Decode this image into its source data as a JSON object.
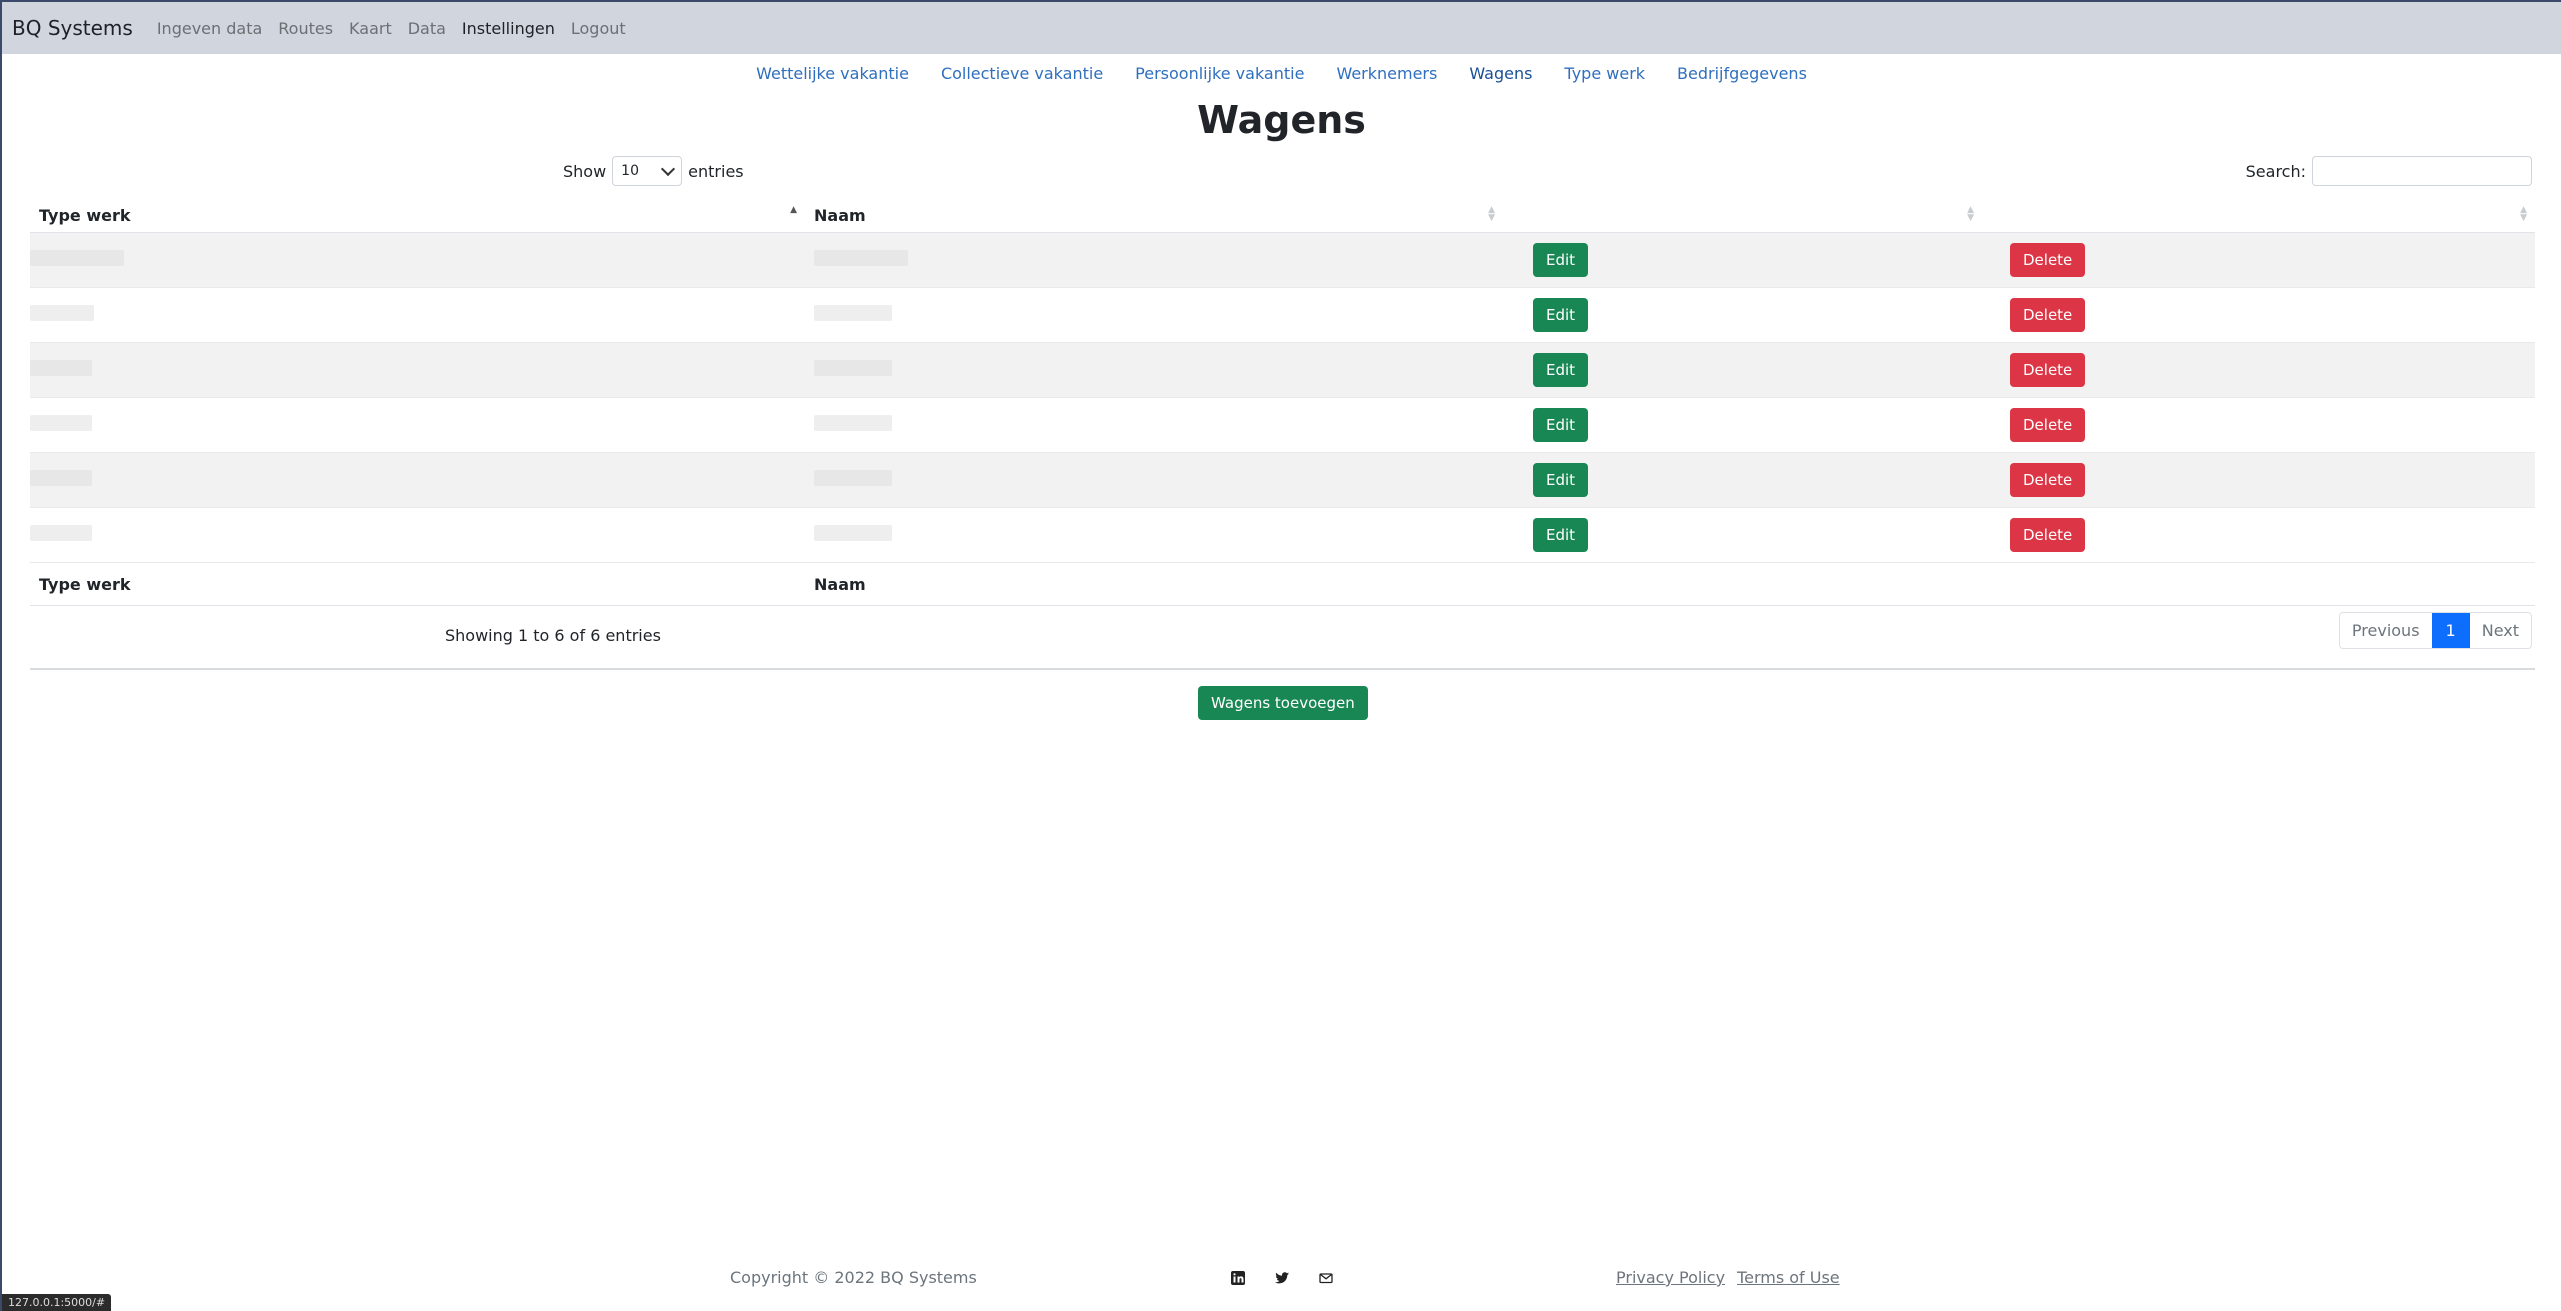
{
  "navbar": {
    "brand": "BQ Systems",
    "links": [
      "Ingeven data",
      "Routes",
      "Kaart",
      "Data",
      "Instellingen",
      "Logout"
    ],
    "active": "Instellingen"
  },
  "subnav": {
    "links": [
      "Wettelijke vakantie",
      "Collectieve vakantie",
      "Persoonlijke vakantie",
      "Werknemers",
      "Wagens",
      "Type werk",
      "Bedrijfgegevens"
    ],
    "active": "Wagens"
  },
  "page": {
    "title": "Wagens"
  },
  "controls": {
    "show_label": "Show",
    "page_length": "10",
    "entries_label": "entries",
    "search_label": "Search:",
    "search_value": ""
  },
  "table": {
    "headers": [
      "Type werk",
      "Naam",
      "",
      ""
    ],
    "footer_headers": [
      "Type werk",
      "Naam"
    ],
    "edit_label": "Edit",
    "delete_label": "Delete",
    "row_count": 6
  },
  "pagination": {
    "info": "Showing 1 to 6 of 6 entries",
    "previous": "Previous",
    "current": "1",
    "next": "Next"
  },
  "actions": {
    "add_label": "Wagens toevoegen"
  },
  "footer": {
    "copyright": "Copyright © 2022 BQ Systems",
    "icons": [
      "linkedin-icon",
      "twitter-icon",
      "mail-icon"
    ],
    "links": [
      "Privacy Policy",
      "Terms of Use"
    ]
  },
  "status_bar": {
    "url": "127.0.0.1:5000/#"
  },
  "colors": {
    "navbar_bg": "#d1d5de",
    "link": "#2f6fbe",
    "edit": "#198754",
    "delete": "#dc3545",
    "pager_active": "#0d6efd"
  }
}
